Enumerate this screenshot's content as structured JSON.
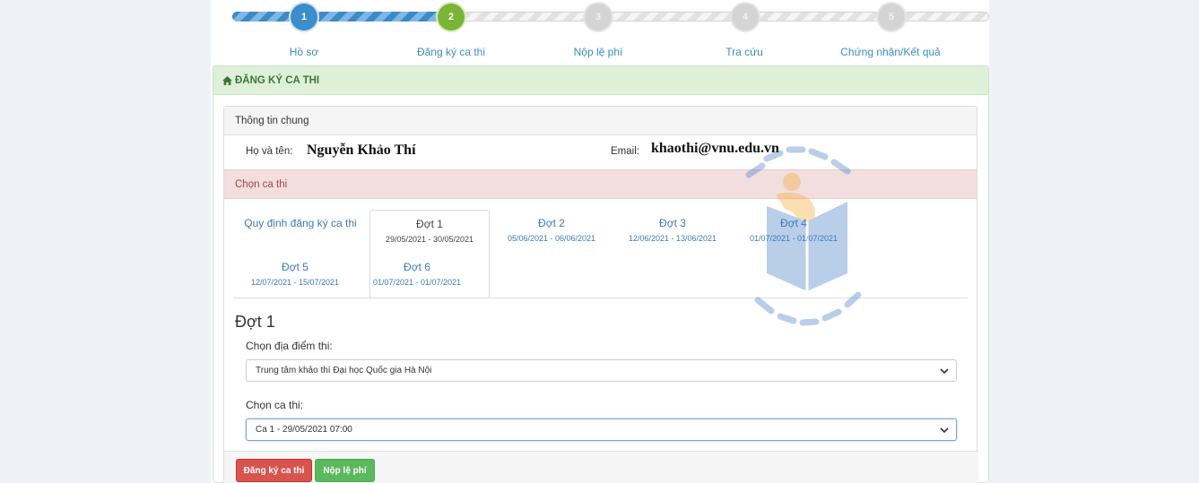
{
  "stepper": {
    "steps": [
      {
        "num": "1",
        "label": "Hồ sơ",
        "state": "done"
      },
      {
        "num": "2",
        "label": "Đăng ký ca thi",
        "state": "active"
      },
      {
        "num": "3",
        "label": "Nộp lệ phí",
        "state": "todo"
      },
      {
        "num": "4",
        "label": "Tra cứu",
        "state": "todo"
      },
      {
        "num": "5",
        "label": "Chứng nhận/Kết quả",
        "state": "todo"
      }
    ]
  },
  "header": {
    "title": "ĐĂNG KÝ CA THI",
    "icon": "home-icon"
  },
  "info": {
    "title": "Thông tin chung",
    "name_label": "Họ và tên:",
    "name": "Nguyễn Khảo Thí",
    "email_label": "Email:",
    "email": "khaothi@vnu.edu.vn"
  },
  "choose": {
    "title": "Chọn ca thi"
  },
  "tabs": {
    "rule_label": "Quy định đăng ký ca thi",
    "items": [
      {
        "name": "Đợt 1",
        "date": "29/05/2021 - 30/05/2021",
        "active": true
      },
      {
        "name": "Đợt 2",
        "date": "05/06/2021 - 06/06/2021",
        "active": false
      },
      {
        "name": "Đợt 3",
        "date": "12/06/2021 - 13/06/2021",
        "active": false
      },
      {
        "name": "Đợt 4",
        "date": "01/07/2021 - 01/07/2021",
        "active": false
      },
      {
        "name": "Đợt 5",
        "date": "12/07/2021 - 15/07/2021",
        "active": false
      },
      {
        "name": "Đợt 6",
        "date": "01/07/2021 - 01/07/2021",
        "active": false
      }
    ]
  },
  "section": {
    "title": "Đợt 1",
    "location_label": "Chọn địa điểm thi:",
    "location_value": "Trung tâm khảo thí Đại học Quốc gia Hà Nội",
    "session_label": "Chọn ca thi:",
    "session_value": "Ca 1 - 29/05/2021 07:00"
  },
  "buttons": {
    "register": "Đăng ký ca thi",
    "pay": "Nộp lệ phí"
  },
  "colors": {
    "primary": "#3c8dcb",
    "success": "#7ab535",
    "danger": "#d9534f",
    "panel_green": "#dff0d8",
    "panel_red": "#f2dede"
  }
}
